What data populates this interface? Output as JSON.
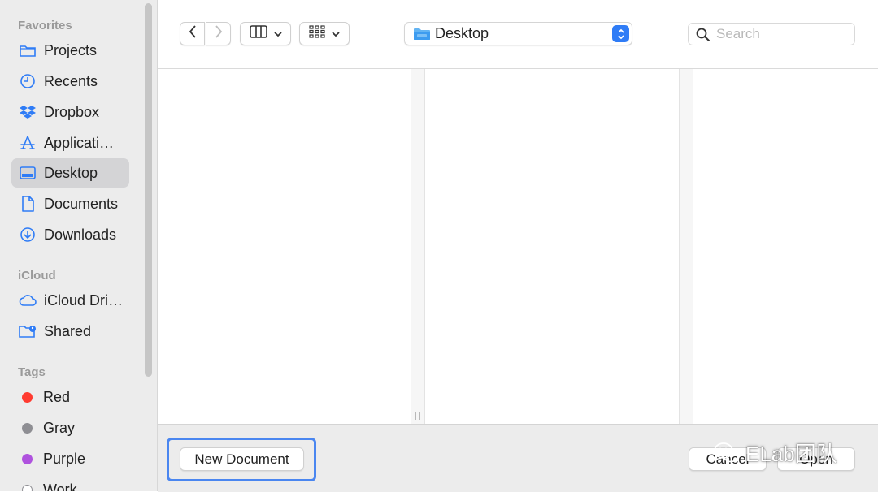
{
  "sidebar": {
    "favorites_title": "Favorites",
    "favorites": [
      {
        "label": "Projects",
        "icon": "folder-icon"
      },
      {
        "label": "Recents",
        "icon": "clock-icon"
      },
      {
        "label": "Dropbox",
        "icon": "dropbox-icon"
      },
      {
        "label": "Applicati…",
        "icon": "applications-icon"
      },
      {
        "label": "Desktop",
        "icon": "desktop-icon",
        "selected": true
      },
      {
        "label": "Documents",
        "icon": "document-icon"
      },
      {
        "label": "Downloads",
        "icon": "downloads-icon"
      }
    ],
    "icloud_title": "iCloud",
    "icloud": [
      {
        "label": "iCloud Dri…",
        "icon": "cloud-icon"
      },
      {
        "label": "Shared",
        "icon": "shared-folder-icon"
      }
    ],
    "tags_title": "Tags",
    "tags": [
      {
        "label": "Red",
        "color": "#ff3b30"
      },
      {
        "label": "Gray",
        "color": "#8e8e93"
      },
      {
        "label": "Purple",
        "color": "#af52de"
      },
      {
        "label": "Work",
        "color": "#ffffff"
      }
    ]
  },
  "toolbar": {
    "back_icon": "chevron-left-icon",
    "forward_icon": "chevron-right-icon",
    "view_icon": "column-view-icon",
    "group_icon": "grid-view-icon",
    "path": {
      "label": "Desktop",
      "icon": "folder-icon"
    },
    "search_placeholder": "Search"
  },
  "bottom": {
    "new_document_label": "New Document",
    "cancel_label": "Cancel",
    "other_label": "Open",
    "watermark": "ELab团队"
  },
  "colors": {
    "accent": "#2f7cf6",
    "highlight": "#4a86f0",
    "sidebar_bg": "#ececec"
  }
}
